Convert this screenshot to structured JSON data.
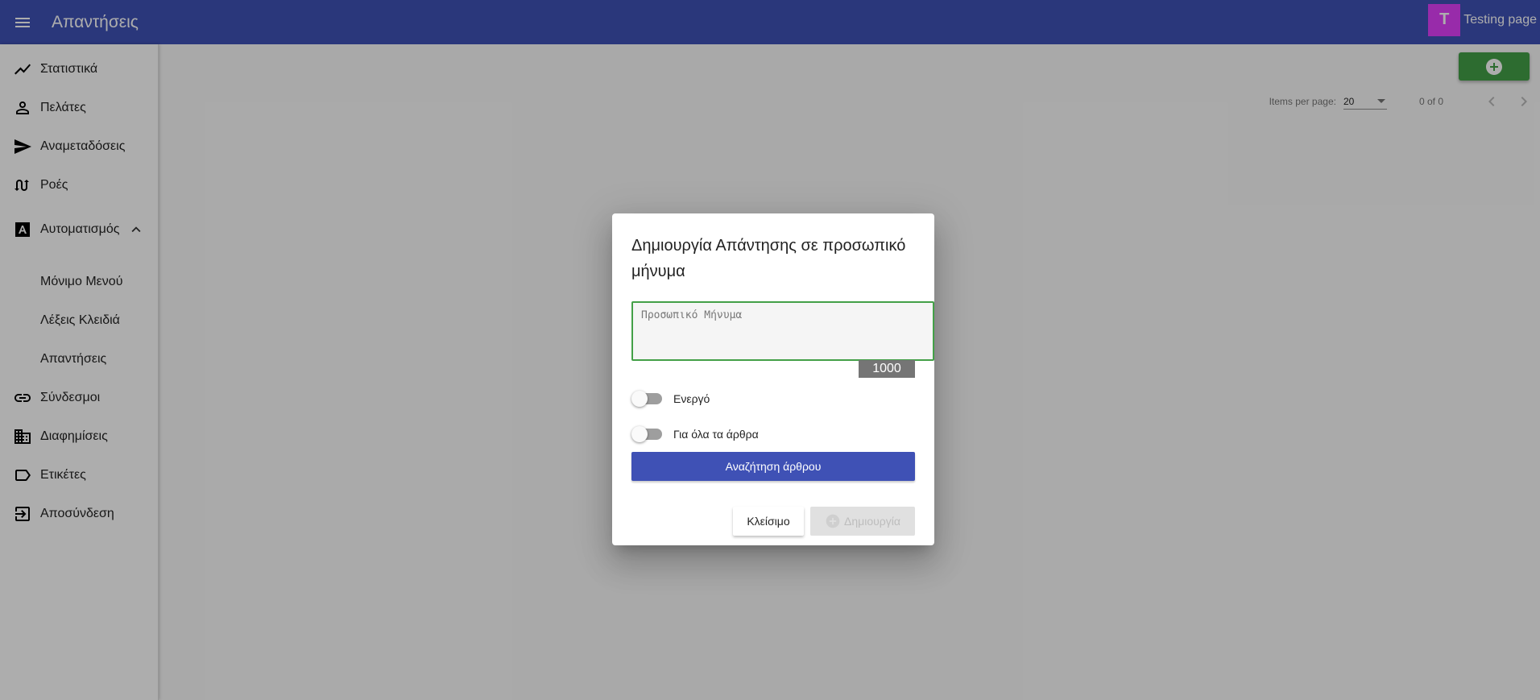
{
  "header": {
    "title": "Απαντήσεις",
    "account_initial": "T",
    "account_name": "Testing page"
  },
  "sidebar": {
    "items": [
      {
        "label": "Στατιστικά",
        "icon": "trending-up-icon"
      },
      {
        "label": "Πελάτες",
        "icon": "person-icon"
      },
      {
        "label": "Αναμεταδόσεις",
        "icon": "send-icon"
      },
      {
        "label": "Ροές",
        "icon": "flows-icon"
      },
      {
        "label": "Αυτοματισμός",
        "icon": "automation-icon"
      },
      {
        "label": "Μόνιμο Μενού"
      },
      {
        "label": "Λέξεις Κλειδιά"
      },
      {
        "label": "Απαντήσεις"
      },
      {
        "label": "Σύνδεσμοι",
        "icon": "link-icon"
      },
      {
        "label": "Διαφημίσεις",
        "icon": "domain-icon"
      },
      {
        "label": "Ετικέτες",
        "icon": "label-icon"
      },
      {
        "label": "Αποσύνδεση",
        "icon": "logout-icon"
      }
    ]
  },
  "paginator": {
    "items_per_page_label": "Items per page:",
    "page_size": "20",
    "range_label": "0 of 0"
  },
  "dialog": {
    "title": "Δημιουργία Απάντησης σε προσωπικό μήνυμα",
    "message_placeholder": "Προσωπικό Μήνυμα",
    "char_counter": "1000",
    "toggle_active_label": "Ενεργό",
    "toggle_all_articles_label": "Για όλα τα άρθρα",
    "search_article_label": "Αναζήτηση άρθρου",
    "close_label": "Κλείσιμο",
    "create_label": "Δημιουργία"
  },
  "colors": {
    "primary": "#3f51b5",
    "accent_green": "#43a047",
    "avatar": "#e040fb"
  }
}
